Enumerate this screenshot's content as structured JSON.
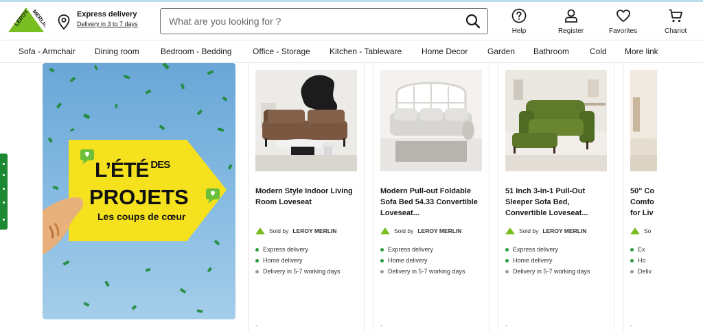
{
  "brand": {
    "logo_text": "LEROY MERLIN",
    "color": "#78be20"
  },
  "delivery": {
    "title": "Express delivery",
    "subtitle": "Delivery in 3 to 7 days",
    "icon": "location-pin-icon"
  },
  "search": {
    "placeholder": "What are you looking for ?",
    "value": "",
    "icon": "search-icon"
  },
  "header_actions": [
    {
      "label": "Help",
      "icon": "help-icon"
    },
    {
      "label": "Register",
      "icon": "user-icon"
    },
    {
      "label": "Favorites",
      "icon": "heart-icon"
    },
    {
      "label": "Chariot",
      "icon": "cart-icon"
    }
  ],
  "categories": [
    "Sofa - Armchair",
    "Dining room",
    "Bedroom - Bedding",
    "Office - Storage",
    "Kitchen - Tableware",
    "Home Decor",
    "Garden",
    "Bathroom",
    "Cold",
    "More link"
  ],
  "promo": {
    "line1": "L’ÉTÉ",
    "line1_small": "DES",
    "line2": "PROJETS",
    "line3": "Les coups de cœur",
    "colors": {
      "sky": "#7fb6e0",
      "tag": "#f5e11d",
      "confetti": "#1d8a33"
    }
  },
  "products": [
    {
      "title": "Modern Style Indoor Living Room Loveseat",
      "seller_prefix": "Sold by",
      "seller": "LEROY MERLIN",
      "features": [
        "Express delivery",
        "Home delivery",
        "Delivery in 5-7 working days"
      ],
      "bottom": "-"
    },
    {
      "title": "Modern Pull-out Foldable Sofa Bed 54.33 Convertible Loveseat...",
      "seller_prefix": "Sold by",
      "seller": "LEROY MERLIN",
      "features": [
        "Express delivery",
        "Home delivery",
        "Delivery in 5-7 working days"
      ],
      "bottom": "-"
    },
    {
      "title": "51 Inch 3-in-1 Pull-Out Sleeper Sofa Bed, Convertible Loveseat...",
      "seller_prefix": "Sold by",
      "seller": "LEROY MERLIN",
      "features": [
        "Express delivery",
        "Home delivery",
        "Delivery in 5-7 working days"
      ],
      "bottom": "-"
    },
    {
      "title": "50\" Co Comfo for Liv",
      "seller_prefix": "So",
      "seller": "",
      "features": [
        "Ex",
        "Ho",
        "Deliv"
      ],
      "bottom": "-"
    }
  ],
  "status_colors": {
    "available": "#2a9d3a",
    "pending": "#9a9a9a"
  }
}
